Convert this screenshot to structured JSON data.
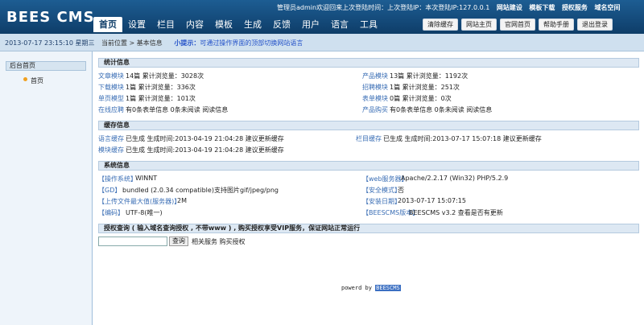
{
  "header": {
    "logo": "BEES CMS",
    "admin_info": "管理员admin欢迎回来上次登陆时间：上次登陆IP：本次登陆IP:127.0.0.1",
    "links": [
      "网站建设",
      "模板下载",
      "授权服务",
      "域名空间"
    ],
    "nav": [
      "首页",
      "设置",
      "栏目",
      "内容",
      "模板",
      "生成",
      "反馈",
      "用户",
      "语言",
      "工具"
    ],
    "buttons": [
      "清除缓存",
      "网站主页",
      "官网首页",
      "帮助手册",
      "退出登录"
    ]
  },
  "subbar": {
    "datetime": "2013-07-17 23:15:10 星期三",
    "crumb": "当前位置 > 基本信息",
    "tip_label": "小提示：",
    "tip_text": "可通过操作界面的顶部切换网站语言"
  },
  "sidebar": {
    "header": "后台首页",
    "item": "首页"
  },
  "stats": {
    "title": "统计信息",
    "rows": [
      {
        "l1": "文章模块",
        "v1": "14篇 累计浏览量：3028次",
        "l2": "产品模块",
        "v2": "13篇 累计浏览量：1192次"
      },
      {
        "l1": "下载模块",
        "v1": "1篇 累计浏览量：336次",
        "l2": "招聘模块",
        "v2": "1篇 累计浏览量：251次"
      },
      {
        "l1": "单页模型",
        "v1": "1篇 累计浏览量：101次",
        "l2": "表单模块",
        "v2": "0篇 累计浏览量：0次"
      },
      {
        "l1": "在线应聘",
        "v1": "有0条表单信息 0条未阅读 阅读信息",
        "l2": "产品购买",
        "v2": "有0条表单信息 0条未阅读 阅读信息"
      }
    ]
  },
  "cache": {
    "title": "缓存信息",
    "rows": [
      {
        "l1": "语言缓存",
        "v1": "已生成  生成时间:2013-04-19 21:04:28 建议更新缓存",
        "l2": "栏目缓存",
        "v2": "已生成  生成时间:2013-07-17 15:07:18 建议更新缓存"
      },
      {
        "l1": "模块缓存",
        "v1": "已生成  生成时间:2013-04-19 21:04:28 建议更新缓存",
        "l2": "",
        "v2": ""
      }
    ]
  },
  "system": {
    "title": "系统信息",
    "rows": [
      {
        "l1": "【操作系统】",
        "v1": "WINNT",
        "l2": "【web服务器】",
        "v2": "Apache/2.2.17 (Win32) PHP/5.2.9"
      },
      {
        "l1": "【GD】",
        "v1": "bundled (2.0.34 compatible)支持图片gif/jpeg/png",
        "l2": "【安全模式】",
        "v2": "否"
      },
      {
        "l1": "【上传文件最大值(服务器)】",
        "v1": "2M",
        "l2": "【安装日期】",
        "v2": "2013-07-17 15:07:15"
      },
      {
        "l1": "【编码】",
        "v1": "UTF-8(唯一)",
        "l2": "【BEESCMS版本】",
        "v2": "BEESCMS v3.2  查看是否有更新"
      }
    ]
  },
  "auth": {
    "title": "授权查询 ( 输入域名查询授权 , 不带www ) , 购买授权享受VIP服务，保证网站正常运行",
    "button": "查询",
    "links": "相关服务 购买授权"
  },
  "footer": {
    "prefix": "powerd by",
    "brand": "BEESCMS"
  }
}
